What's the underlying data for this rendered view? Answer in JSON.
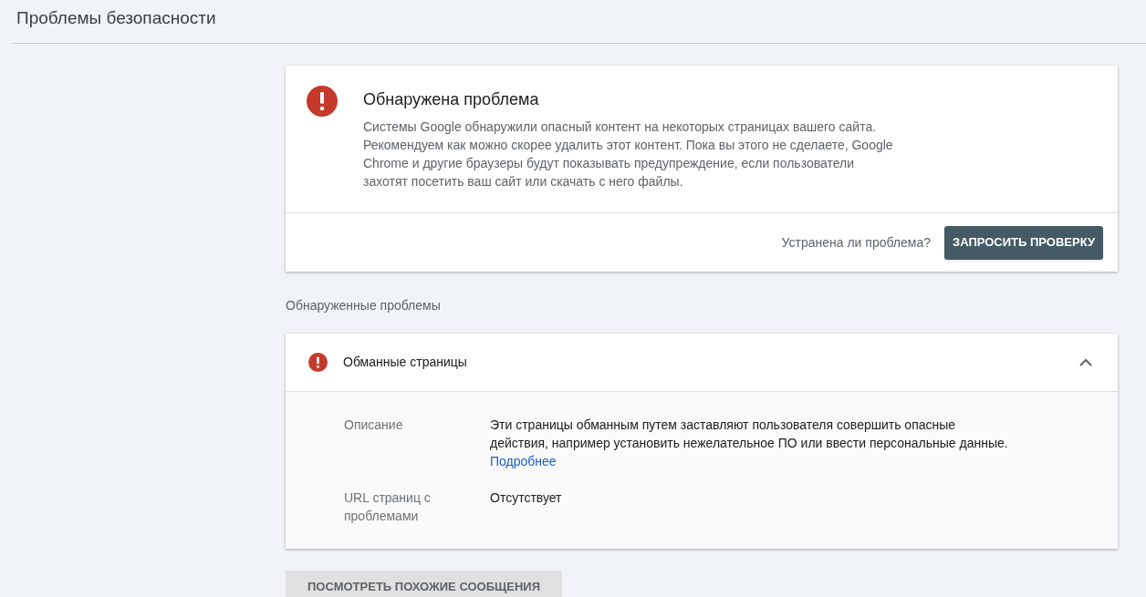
{
  "page_title": "Проблемы безопасности",
  "alert": {
    "title": "Обнаружена проблема",
    "text": "Системы Google обнаружили опасный контент на некоторых страницах вашего сайта. Рекомендуем как можно скорее удалить этот контент. Пока вы этого не сделаете, Google Chrome и другие браузеры будут показывать предупреждение, если пользователи захотят посетить ваш сайт или скачать с него файлы.",
    "question": "Устранена ли проблема?",
    "button": "ЗАПРОСИТЬ ПРОВЕРКУ"
  },
  "issues_heading": "Обнаруженные проблемы",
  "issues": [
    {
      "title": "Обманные страницы",
      "expanded": true,
      "details": [
        {
          "label": "Описание",
          "value": "Эти страницы обманным путем заставляют пользователя совершить опасные действия, например установить нежелательное ПО или ввести персональные данные.",
          "link": "Подробнее"
        },
        {
          "label": "URL страниц с проблемами",
          "value": "Отсутствует"
        }
      ]
    }
  ],
  "footer_button": "ПОСМОТРЕТЬ ПОХОЖИЕ СООБЩЕНИЯ"
}
